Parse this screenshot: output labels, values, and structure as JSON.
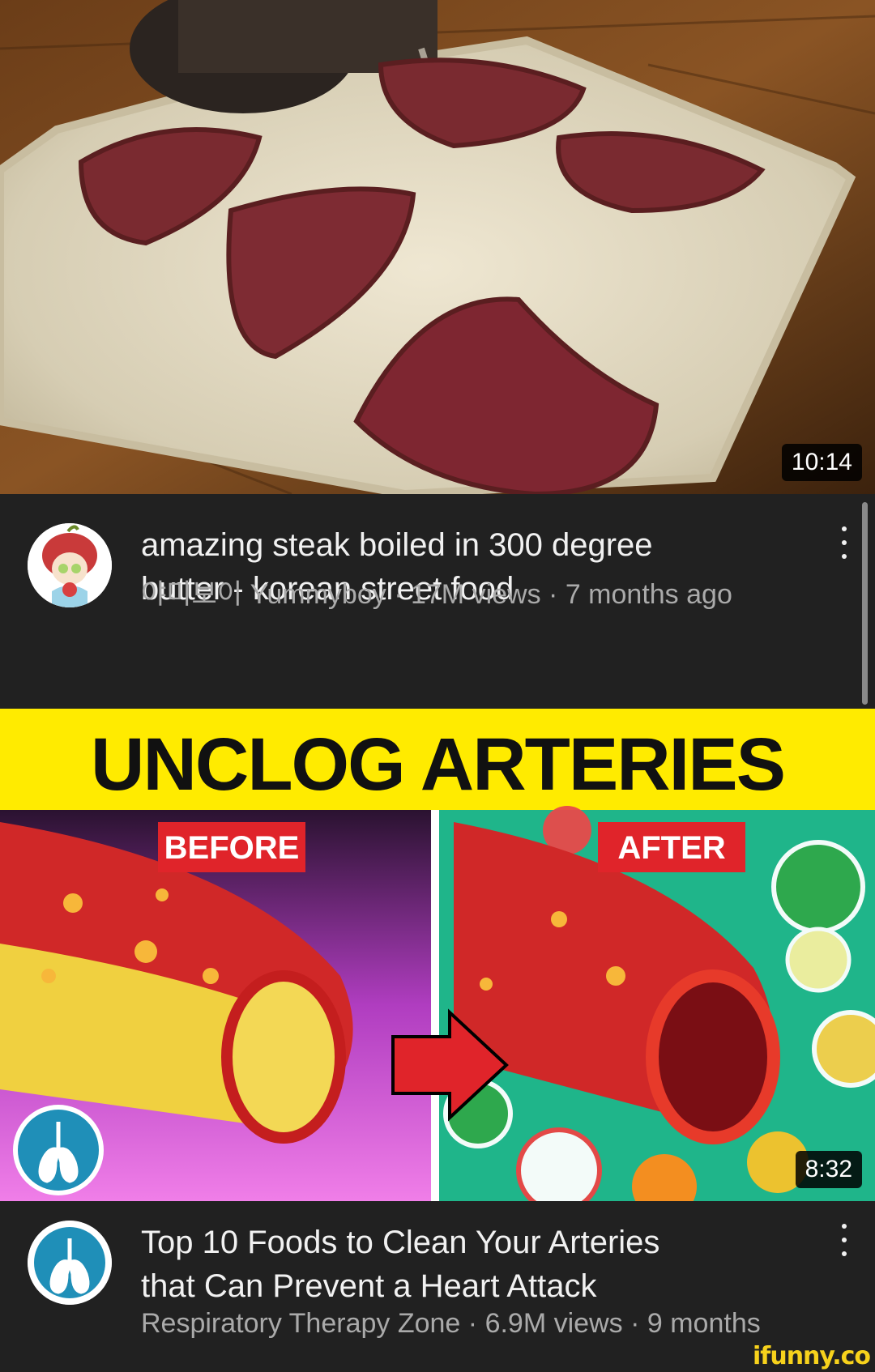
{
  "videos": [
    {
      "title_line1": "amazing steak boiled in 300 degree",
      "title_line2": "butter - korean street food",
      "channel": "야미보이 Yummyboy",
      "views": "17M views",
      "age": "7 months ago",
      "duration": "10:14"
    },
    {
      "thumb_heading": "UNCLOG ARTERIES",
      "before_label": "BEFORE",
      "after_label": "AFTER",
      "title_line1": "Top 10 Foods to Clean Your Arteries",
      "title_line2": "that Can Prevent a Heart Attack",
      "channel": "Respiratory Therapy Zone",
      "views": "6.9M views",
      "age": "9 months",
      "duration": "8:32"
    }
  ],
  "separator": "·",
  "watermark": "ifunny.co"
}
